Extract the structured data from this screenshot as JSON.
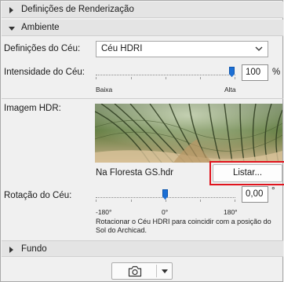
{
  "sections": {
    "render_settings": "Definições de Renderização",
    "environment": "Ambiente",
    "background": "Fundo"
  },
  "sky_settings": {
    "label": "Definições do Céu:",
    "selected": "Céu HDRI"
  },
  "sky_intensity": {
    "label": "Intensidade do Céu:",
    "value": "100",
    "unit": "%",
    "min_label": "Baixa",
    "max_label": "Alta",
    "level_percent": 100
  },
  "hdr_image": {
    "label": "Imagem HDR:",
    "filename": "Na Floresta GS.hdr",
    "browse_button": "Listar..."
  },
  "sky_rotation": {
    "label": "Rotação do Céu:",
    "value": "0,00",
    "unit": "°",
    "min_label": "-180°",
    "mid_label": "0°",
    "max_label": "180°",
    "note": "Rotacionar o Céu HDRI para coincidir com a posição do Sol do Archicad."
  },
  "icons": {
    "expand": "triangle-right-icon",
    "collapse": "triangle-down-icon",
    "dropdown": "chevron-down-icon",
    "camera": "camera-icon"
  },
  "colors": {
    "accent": "#1c6fd4",
    "highlight": "#e0141e"
  }
}
